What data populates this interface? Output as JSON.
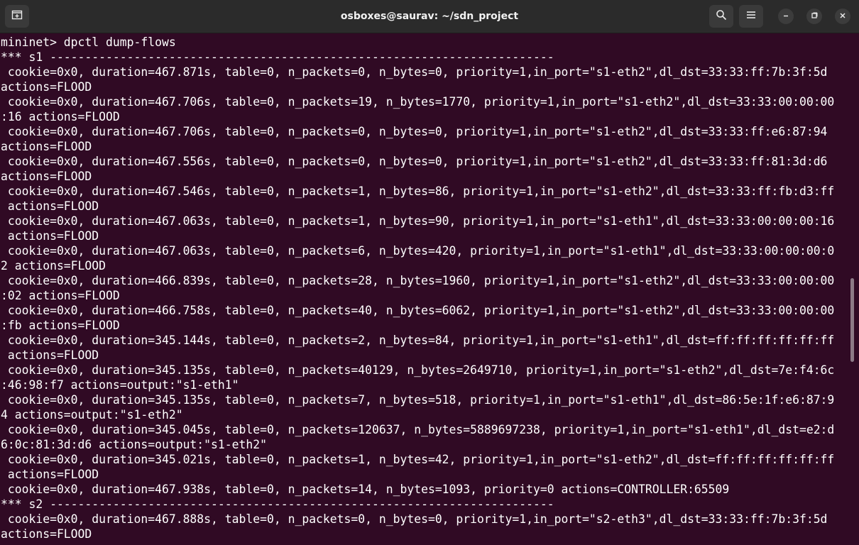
{
  "window": {
    "title": "osboxes@saurav: ~/sdn_project"
  },
  "icons": {
    "new_tab": "new-tab-icon",
    "search": "search-icon",
    "menu": "hamburger-menu-icon",
    "minimize": "minimize-icon",
    "maximize": "maximize-icon",
    "close": "close-icon"
  },
  "colors": {
    "terminal_bg": "#300a24",
    "titlebar_bg": "#2b2b2b",
    "text": "#ffffff"
  },
  "terminal": {
    "lines": [
      "mininet> dpctl dump-flows",
      "*** s1 ------------------------------------------------------------------------",
      " cookie=0x0, duration=467.871s, table=0, n_packets=0, n_bytes=0, priority=1,in_port=\"s1-eth2\",dl_dst=33:33:ff:7b:3f:5d",
      "actions=FLOOD",
      " cookie=0x0, duration=467.706s, table=0, n_packets=19, n_bytes=1770, priority=1,in_port=\"s1-eth2\",dl_dst=33:33:00:00:00",
      ":16 actions=FLOOD",
      " cookie=0x0, duration=467.706s, table=0, n_packets=0, n_bytes=0, priority=1,in_port=\"s1-eth2\",dl_dst=33:33:ff:e6:87:94",
      "actions=FLOOD",
      " cookie=0x0, duration=467.556s, table=0, n_packets=0, n_bytes=0, priority=1,in_port=\"s1-eth2\",dl_dst=33:33:ff:81:3d:d6",
      "actions=FLOOD",
      " cookie=0x0, duration=467.546s, table=0, n_packets=1, n_bytes=86, priority=1,in_port=\"s1-eth2\",dl_dst=33:33:ff:fb:d3:ff",
      " actions=FLOOD",
      " cookie=0x0, duration=467.063s, table=0, n_packets=1, n_bytes=90, priority=1,in_port=\"s1-eth1\",dl_dst=33:33:00:00:00:16",
      " actions=FLOOD",
      " cookie=0x0, duration=467.063s, table=0, n_packets=6, n_bytes=420, priority=1,in_port=\"s1-eth1\",dl_dst=33:33:00:00:00:0",
      "2 actions=FLOOD",
      " cookie=0x0, duration=466.839s, table=0, n_packets=28, n_bytes=1960, priority=1,in_port=\"s1-eth2\",dl_dst=33:33:00:00:00",
      ":02 actions=FLOOD",
      " cookie=0x0, duration=466.758s, table=0, n_packets=40, n_bytes=6062, priority=1,in_port=\"s1-eth2\",dl_dst=33:33:00:00:00",
      ":fb actions=FLOOD",
      " cookie=0x0, duration=345.144s, table=0, n_packets=2, n_bytes=84, priority=1,in_port=\"s1-eth1\",dl_dst=ff:ff:ff:ff:ff:ff",
      " actions=FLOOD",
      " cookie=0x0, duration=345.135s, table=0, n_packets=40129, n_bytes=2649710, priority=1,in_port=\"s1-eth2\",dl_dst=7e:f4:6c",
      ":46:98:f7 actions=output:\"s1-eth1\"",
      " cookie=0x0, duration=345.135s, table=0, n_packets=7, n_bytes=518, priority=1,in_port=\"s1-eth1\",dl_dst=86:5e:1f:e6:87:9",
      "4 actions=output:\"s1-eth2\"",
      " cookie=0x0, duration=345.045s, table=0, n_packets=120637, n_bytes=5889697238, priority=1,in_port=\"s1-eth1\",dl_dst=e2:d",
      "6:0c:81:3d:d6 actions=output:\"s1-eth2\"",
      " cookie=0x0, duration=345.021s, table=0, n_packets=1, n_bytes=42, priority=1,in_port=\"s1-eth2\",dl_dst=ff:ff:ff:ff:ff:ff",
      " actions=FLOOD",
      " cookie=0x0, duration=467.938s, table=0, n_packets=14, n_bytes=1093, priority=0 actions=CONTROLLER:65509",
      "*** s2 ------------------------------------------------------------------------",
      " cookie=0x0, duration=467.888s, table=0, n_packets=0, n_bytes=0, priority=1,in_port=\"s2-eth3\",dl_dst=33:33:ff:7b:3f:5d",
      "actions=FLOOD"
    ]
  }
}
